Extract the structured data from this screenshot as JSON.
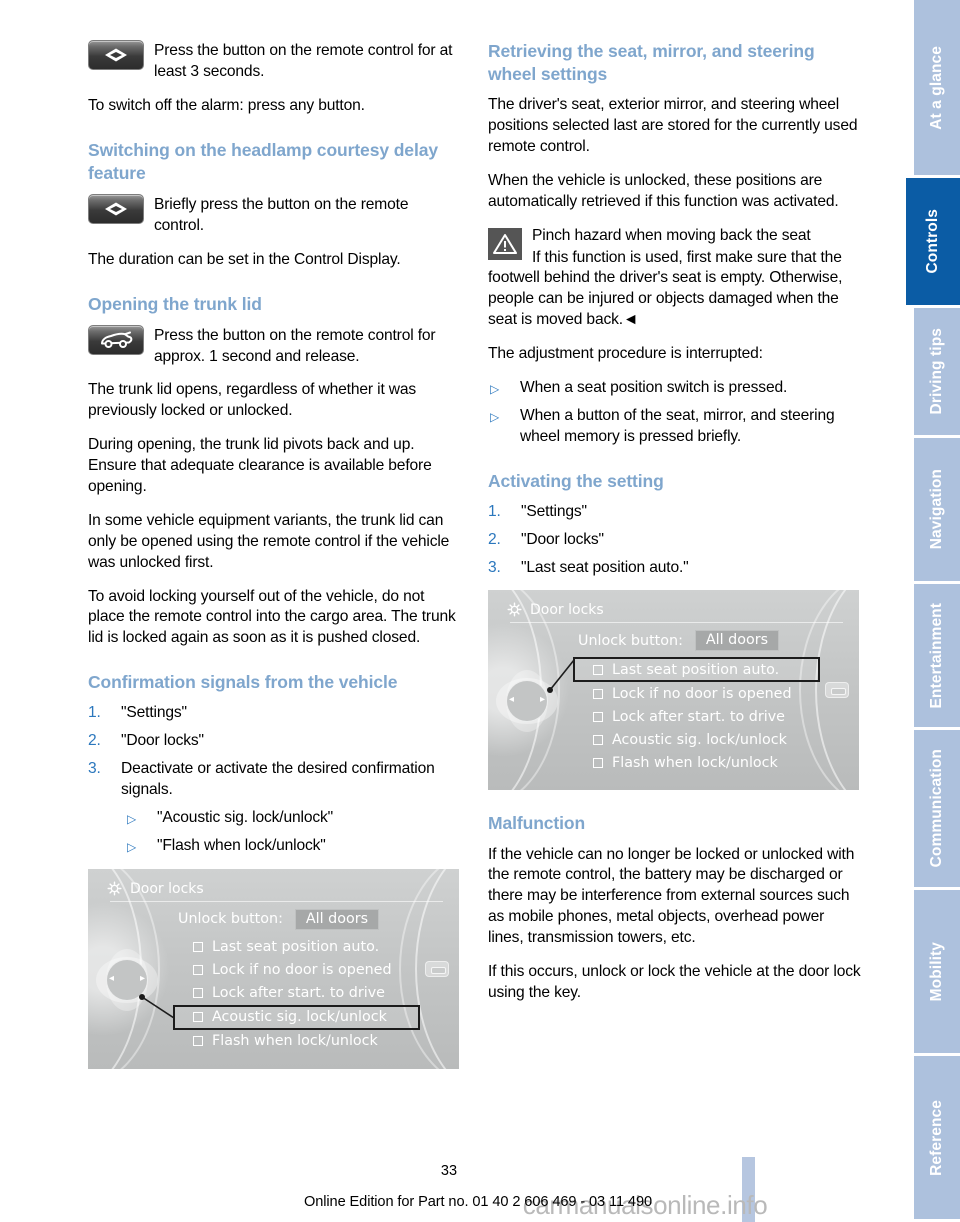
{
  "page": {
    "number": "33",
    "footer": "Online Edition for Part no. 01 40 2 606 469 - 03 11 490",
    "watermark": "carmanualsonline.info"
  },
  "colors": {
    "heading_blue": "#7fa6cd",
    "accent_blue": "#2b77bd",
    "tab_inactive": "#adc1dd",
    "tab_active": "#0b5ca5"
  },
  "tabs": [
    {
      "label": "At a glance",
      "active": false
    },
    {
      "label": "Controls",
      "active": true
    },
    {
      "label": "Driving tips",
      "active": false
    },
    {
      "label": "Navigation",
      "active": false
    },
    {
      "label": "Entertainment",
      "active": false
    },
    {
      "label": "Communication",
      "active": false
    },
    {
      "label": "Mobility",
      "active": false
    },
    {
      "label": "Reference",
      "active": false
    }
  ],
  "left_column": {
    "alarm_icon_text": "Press the button on the remote control for at least 3 seconds.",
    "alarm_off_text": "To switch off the alarm: press any button.",
    "headlamp_heading": "Switching on the headlamp courtesy delay feature",
    "headlamp_icon_text": "Briefly press the button on the remote control.",
    "headlamp_duration_text": "The duration can be set in the Control Display.",
    "trunk_heading": "Opening the trunk lid",
    "trunk_icon_text": "Press the button on the remote control for approx. 1 second and release.",
    "trunk_p1": "The trunk lid opens, regardless of whether it was previously locked or unlocked.",
    "trunk_p2": "During opening, the trunk lid pivots back and up. Ensure that adequate clearance is available before opening.",
    "trunk_p3": "In some vehicle equipment variants, the trunk lid can only be opened using the remote control if the vehicle was unlocked first.",
    "trunk_p4": "To avoid locking yourself out of the vehicle, do not place the remote control into the cargo area. The trunk lid is locked again as soon as it is pushed closed.",
    "confirmation_heading": "Confirmation signals from the vehicle",
    "confirmation_steps": [
      {
        "num": "1.",
        "text": "\"Settings\""
      },
      {
        "num": "2.",
        "text": "\"Door locks\""
      },
      {
        "num": "3.",
        "text": "Deactivate or activate the desired confirmation signals."
      }
    ],
    "confirmation_subitems": [
      "\"Acoustic sig. lock/unlock\"",
      "\"Flash when lock/unlock\""
    ]
  },
  "right_column": {
    "retrieving_heading": "Retrieving the seat, mirror, and steering wheel settings",
    "retrieving_p1": "The driver's seat, exterior mirror, and steering wheel positions selected last are stored for the currently used remote control.",
    "retrieving_p2": "When the vehicle is unlocked, these positions are automatically retrieved if this function was activated.",
    "warning_title": "Pinch hazard when moving back the seat",
    "warning_body": "If this function is used, first make sure that the footwell behind the driver's seat is empty. Otherwise, people can be injured or objects damaged when the seat is moved back.◄",
    "interrupt_intro": "The adjustment procedure is interrupted:",
    "interrupt_items": [
      "When a seat position switch is pressed.",
      "When a button of the seat, mirror, and steering wheel memory is pressed briefly."
    ],
    "activating_heading": "Activating the setting",
    "activating_steps": [
      {
        "num": "1.",
        "text": "\"Settings\""
      },
      {
        "num": "2.",
        "text": "\"Door locks\""
      },
      {
        "num": "3.",
        "text": "\"Last seat position auto.\""
      }
    ],
    "malfunction_heading": "Malfunction",
    "malfunction_p1": "If the vehicle can no longer be locked or unlocked with the remote control, the battery may be discharged or there may be interference from external sources such as mobile phones, metal objects, overhead power lines, transmission towers, etc.",
    "malfunction_p2": "If this occurs, unlock or lock the vehicle at the door lock using the key."
  },
  "idrive_top": {
    "title": "Door locks",
    "unlock_label": "Unlock button:",
    "unlock_value": "All doors",
    "options": [
      {
        "label": "Last seat position auto.",
        "selected": true
      },
      {
        "label": "Lock if no door is opened",
        "selected": false
      },
      {
        "label": "Lock after start. to drive",
        "selected": false
      },
      {
        "label": "Acoustic sig. lock/unlock",
        "selected": false
      },
      {
        "label": "Flash when lock/unlock",
        "selected": false
      }
    ]
  },
  "idrive_bottom": {
    "title": "Door locks",
    "unlock_label": "Unlock button:",
    "unlock_value": "All doors",
    "options": [
      {
        "label": "Last seat position auto.",
        "selected": false
      },
      {
        "label": "Lock if no door is opened",
        "selected": false
      },
      {
        "label": "Lock after start. to drive",
        "selected": false
      },
      {
        "label": "Acoustic sig. lock/unlock",
        "selected": true
      },
      {
        "label": "Flash when lock/unlock",
        "selected": false
      }
    ]
  },
  "icons": {
    "alarm_button": "remote-alarm-diamond-icon",
    "headlamp_button": "remote-alarm-diamond-icon",
    "trunk_button": "remote-trunk-car-icon",
    "warning": "warning-triangle-icon",
    "idrive_settings": "gear-icon",
    "idrive_controller": "idrive-controller-icon"
  }
}
